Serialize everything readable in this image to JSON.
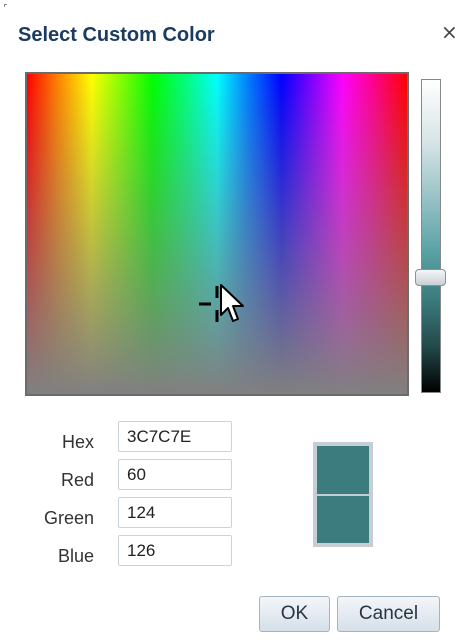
{
  "dialog": {
    "title": "Select Custom Color",
    "close_glyph": "×"
  },
  "fields": {
    "hex_label": "Hex",
    "hex_value": "3C7C7E",
    "red_label": "Red",
    "red_value": "60",
    "green_label": "Green",
    "green_value": "124",
    "blue_label": "Blue",
    "blue_value": "126"
  },
  "preview": {
    "new_color": "#3c7c7e",
    "current_color": "#3c7c7e"
  },
  "buttons": {
    "ok": "OK",
    "cancel": "Cancel"
  },
  "icons": {
    "close": "close-icon",
    "crosshair": "crosshair-icon",
    "cursor": "mouse-pointer-icon"
  }
}
